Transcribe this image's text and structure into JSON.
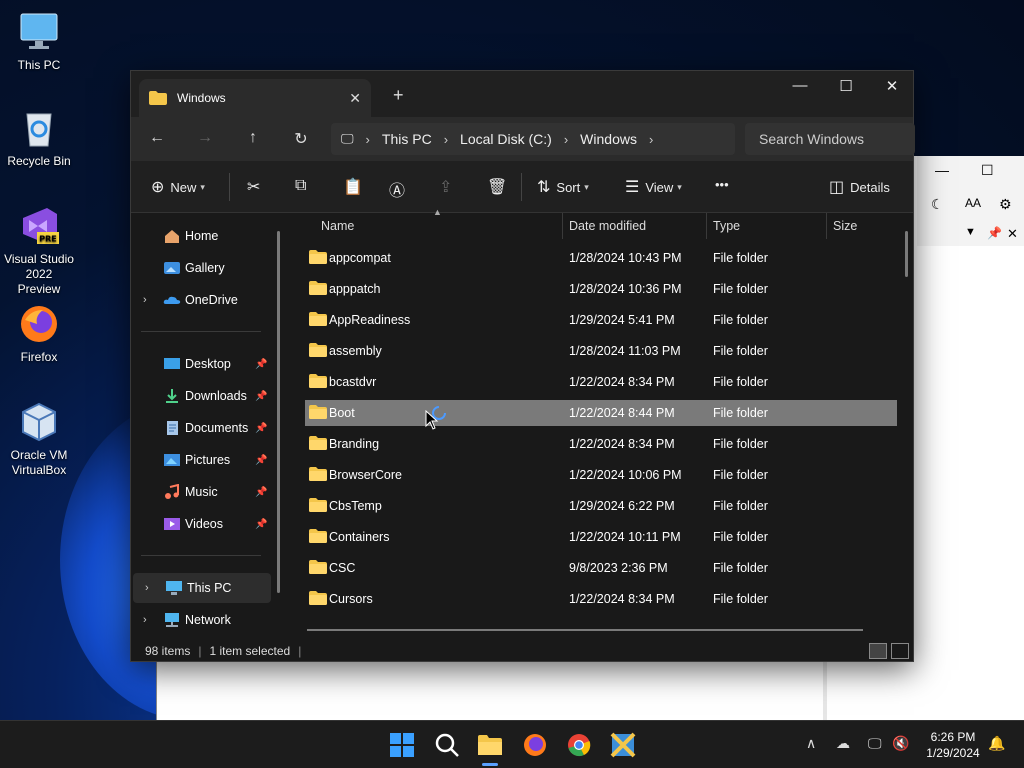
{
  "desktop": {
    "icons": [
      {
        "label": "This PC",
        "icon": "monitor-icon"
      },
      {
        "label": "Recycle Bin",
        "icon": "recycle-bin-icon"
      },
      {
        "label": "Visual Studio 2022 Preview",
        "icon": "visual-studio-icon",
        "badge": "PRE"
      },
      {
        "label": "Firefox",
        "icon": "firefox-icon"
      },
      {
        "label": "Oracle VM VirtualBox",
        "icon": "virtualbox-icon"
      }
    ]
  },
  "explorer": {
    "tab_title": "Windows",
    "address": {
      "crumbs": [
        "This PC",
        "Local Disk (C:)",
        "Windows"
      ]
    },
    "search_placeholder": "Search Windows",
    "toolbar": {
      "new_label": "New",
      "sort_label": "Sort",
      "view_label": "View",
      "more_label": "•••",
      "details_label": "Details"
    },
    "nav_pane": {
      "home": "Home",
      "gallery": "Gallery",
      "onedrive": "OneDrive",
      "desktop": "Desktop",
      "downloads": "Downloads",
      "documents": "Documents",
      "pictures": "Pictures",
      "music": "Music",
      "videos": "Videos",
      "this_pc": "This PC",
      "network": "Network"
    },
    "columns": {
      "name": "Name",
      "date": "Date modified",
      "type": "Type",
      "size": "Size"
    },
    "rows": [
      {
        "name": "appcompat",
        "date": "1/28/2024 10:43 PM",
        "type": "File folder"
      },
      {
        "name": "apppatch",
        "date": "1/28/2024 10:36 PM",
        "type": "File folder"
      },
      {
        "name": "AppReadiness",
        "date": "1/29/2024 5:41 PM",
        "type": "File folder"
      },
      {
        "name": "assembly",
        "date": "1/28/2024 11:03 PM",
        "type": "File folder"
      },
      {
        "name": "bcastdvr",
        "date": "1/22/2024 8:34 PM",
        "type": "File folder"
      },
      {
        "name": "Boot",
        "date": "1/22/2024 8:44 PM",
        "type": "File folder",
        "selected": true
      },
      {
        "name": "Branding",
        "date": "1/22/2024 8:34 PM",
        "type": "File folder"
      },
      {
        "name": "BrowserCore",
        "date": "1/22/2024 10:06 PM",
        "type": "File folder"
      },
      {
        "name": "CbsTemp",
        "date": "1/29/2024 6:22 PM",
        "type": "File folder"
      },
      {
        "name": "Containers",
        "date": "1/22/2024 10:11 PM",
        "type": "File folder"
      },
      {
        "name": "CSC",
        "date": "9/8/2023 2:36 PM",
        "type": "File folder"
      },
      {
        "name": "Cursors",
        "date": "1/22/2024 8:34 PM",
        "type": "File folder"
      }
    ],
    "status": {
      "items": "98 items",
      "selected": "1 item selected"
    }
  },
  "taskbar": {
    "time": "6:26 PM",
    "date": "1/29/2024"
  },
  "colors": {
    "folder": "#f4c64a",
    "selected_row": "#7a7a7a",
    "accent": "#4c9aff"
  }
}
